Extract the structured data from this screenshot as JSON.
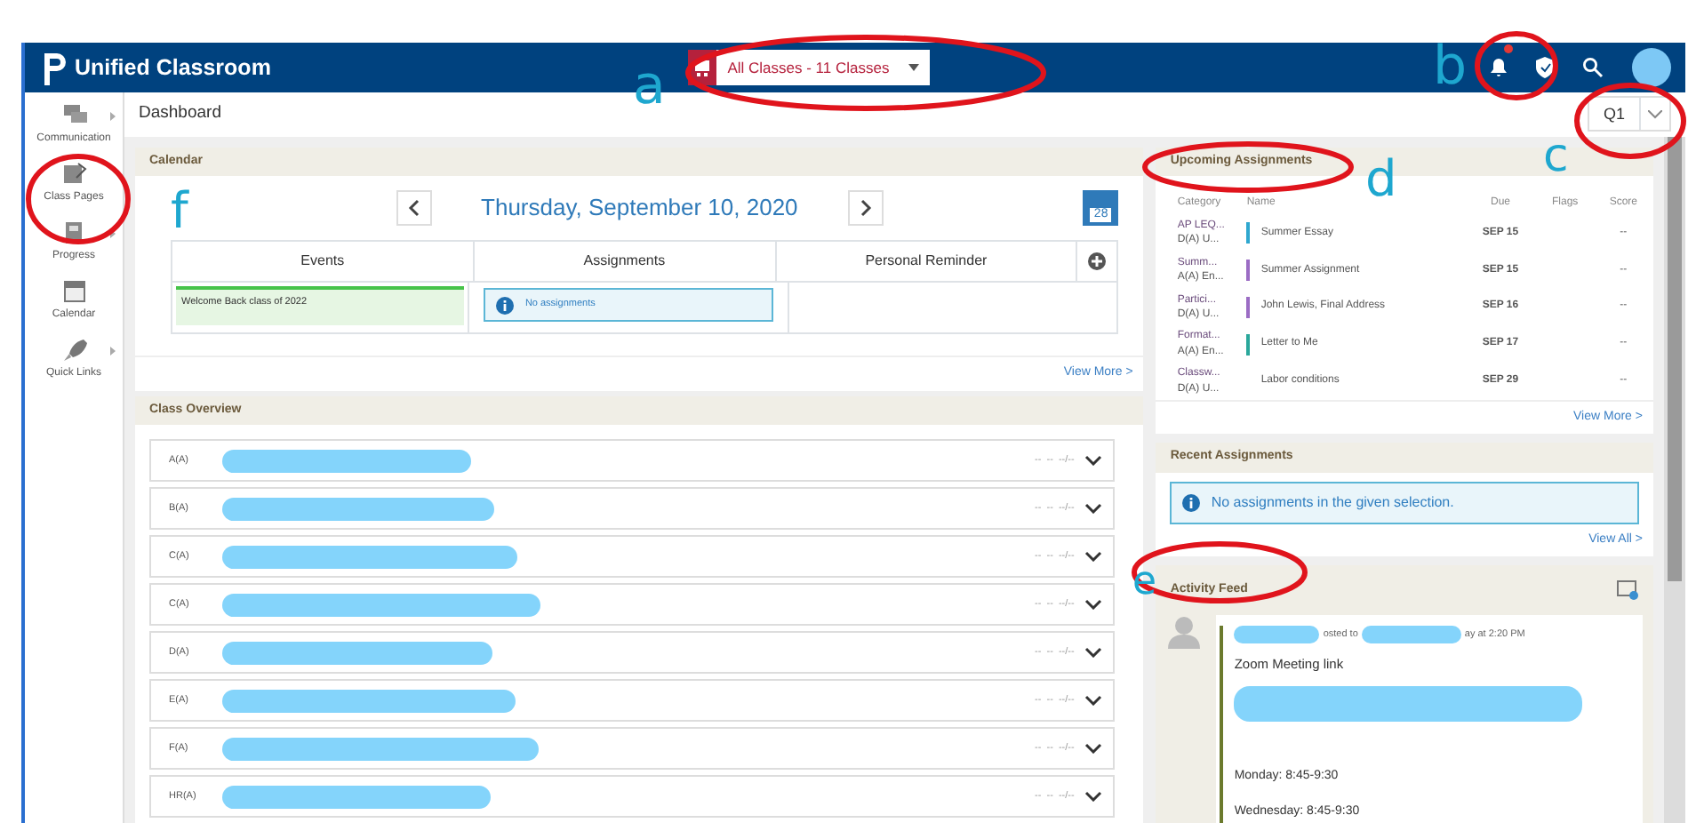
{
  "topbar": {
    "title": "Unified Classroom",
    "class_selector": "All Classes - 11 Classes",
    "notifications": true
  },
  "sidebar": [
    {
      "label": "Communication",
      "submenu": true
    },
    {
      "label": "Class Pages",
      "submenu": false
    },
    {
      "label": "Progress",
      "submenu": true
    },
    {
      "label": "Calendar",
      "submenu": false
    },
    {
      "label": "Quick Links",
      "submenu": true
    }
  ],
  "page_title": "Dashboard",
  "term_selector": "Q1",
  "calendar": {
    "title": "Calendar",
    "date": "Thursday, September 10, 2020",
    "calendar_icon_day": "28",
    "columns": [
      "Events",
      "Assignments",
      "Personal Reminder"
    ],
    "event": "Welcome Back class of 2022",
    "assignments_note": "No assignments",
    "view_more": "View More >"
  },
  "class_overview": {
    "title": "Class Overview",
    "rows": [
      {
        "label": "A(A)",
        "redacted": true,
        "grades": "--  --  --/--"
      },
      {
        "label": "B(A)",
        "redacted": true,
        "grades": "--  --  --/--"
      },
      {
        "label": "C(A)",
        "redacted": true,
        "grades": "--  --  --/--"
      },
      {
        "label": "C(A)",
        "redacted": true,
        "grades": "--  --  --/--"
      },
      {
        "label": "D(A)",
        "redacted": true,
        "grades": "--  --  --/--"
      },
      {
        "label": "E(A)",
        "redacted": true,
        "grades": "--  --  --/--"
      },
      {
        "label": "F(A)",
        "redacted": true,
        "grades": "--  --  --/--"
      },
      {
        "label": "HR(A)",
        "redacted": true,
        "grades": "--  --  --/--"
      }
    ]
  },
  "upcoming": {
    "title": "Upcoming Assignments",
    "columns": [
      "Category",
      "Name",
      "Due",
      "Flags",
      "Score"
    ],
    "rows": [
      {
        "category": "AP LEQ...",
        "class": "D(A) U...",
        "color": "#2fa7cf",
        "name": "Summer Essay",
        "due": "SEP 15",
        "score": "--"
      },
      {
        "category": "Summ...",
        "class": "A(A) En...",
        "color": "#9b6cc4",
        "name": "Summer Assignment",
        "due": "SEP 15",
        "score": "--"
      },
      {
        "category": "Partici...",
        "class": "D(A) U...",
        "color": "#9b6cc4",
        "name": "John Lewis, Final Address",
        "due": "SEP 16",
        "score": "--"
      },
      {
        "category": "Format...",
        "class": "A(A) En...",
        "color": "#2aa79b",
        "name": "Letter to Me",
        "due": "SEP 17",
        "score": "--"
      },
      {
        "category": "Classw...",
        "class": "D(A) U...",
        "name": "Labor conditions",
        "due": "SEP 29",
        "score": "--"
      }
    ],
    "view_more": "View More >"
  },
  "recent": {
    "title": "Recent Assignments",
    "note": "No assignments in the given selection.",
    "view_all": "View All >"
  },
  "activity": {
    "title": "Activity Feed",
    "post": {
      "meta": [
        "osted to",
        "ay at 2:20 PM"
      ],
      "heading": "Zoom Meeting link",
      "lines": [
        "Monday: 8:45-9:30",
        "Wednesday: 8:45-9:30"
      ]
    }
  },
  "annotations": [
    {
      "kind": "circle"
    },
    {
      "kind": "circle"
    },
    {
      "kind": "circle"
    },
    {
      "kind": "circle"
    },
    {
      "kind": "circle"
    },
    {
      "kind": "circle"
    },
    {
      "kind": "letter",
      "text": "a"
    },
    {
      "kind": "letter",
      "text": "b"
    },
    {
      "kind": "letter",
      "text": "f"
    },
    {
      "kind": "letter",
      "text": "d"
    },
    {
      "kind": "letter",
      "text": "c"
    },
    {
      "kind": "letter",
      "text": "e"
    }
  ]
}
